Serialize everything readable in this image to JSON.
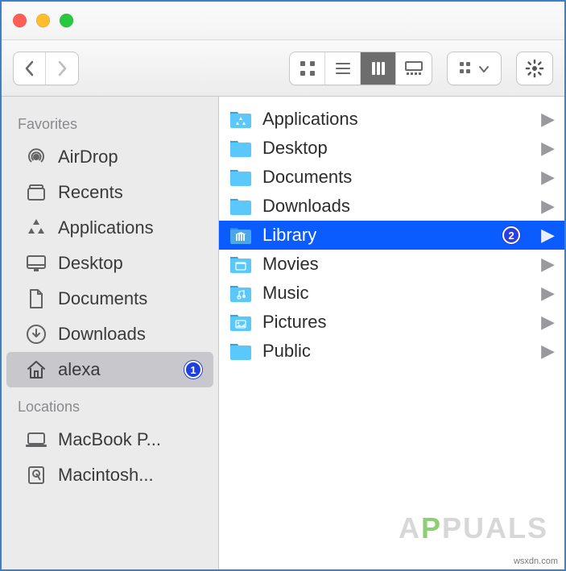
{
  "sidebar": {
    "section_favorites": "Favorites",
    "section_locations": "Locations",
    "favorites": [
      {
        "label": "AirDrop",
        "icon": "airdrop"
      },
      {
        "label": "Recents",
        "icon": "recents"
      },
      {
        "label": "Applications",
        "icon": "apps"
      },
      {
        "label": "Desktop",
        "icon": "desktop"
      },
      {
        "label": "Documents",
        "icon": "documents"
      },
      {
        "label": "Downloads",
        "icon": "downloads"
      },
      {
        "label": "alexa",
        "icon": "home",
        "selected": true,
        "badge": "1"
      }
    ],
    "locations": [
      {
        "label": "MacBook P...",
        "icon": "laptop"
      },
      {
        "label": "Macintosh...",
        "icon": "hdd"
      }
    ]
  },
  "content": {
    "items": [
      {
        "label": "Applications",
        "glyph": "apps"
      },
      {
        "label": "Desktop",
        "glyph": "blank"
      },
      {
        "label": "Documents",
        "glyph": "blank"
      },
      {
        "label": "Downloads",
        "glyph": "blank"
      },
      {
        "label": "Library",
        "glyph": "library",
        "selected": true,
        "badge": "2"
      },
      {
        "label": "Movies",
        "glyph": "movies"
      },
      {
        "label": "Music",
        "glyph": "music"
      },
      {
        "label": "Pictures",
        "glyph": "pictures"
      },
      {
        "label": "Public",
        "glyph": "blank"
      }
    ]
  },
  "watermark": {
    "pre": "A",
    "mid": "P",
    "post": "PUALS"
  },
  "sitemark": "wsxdn.com"
}
